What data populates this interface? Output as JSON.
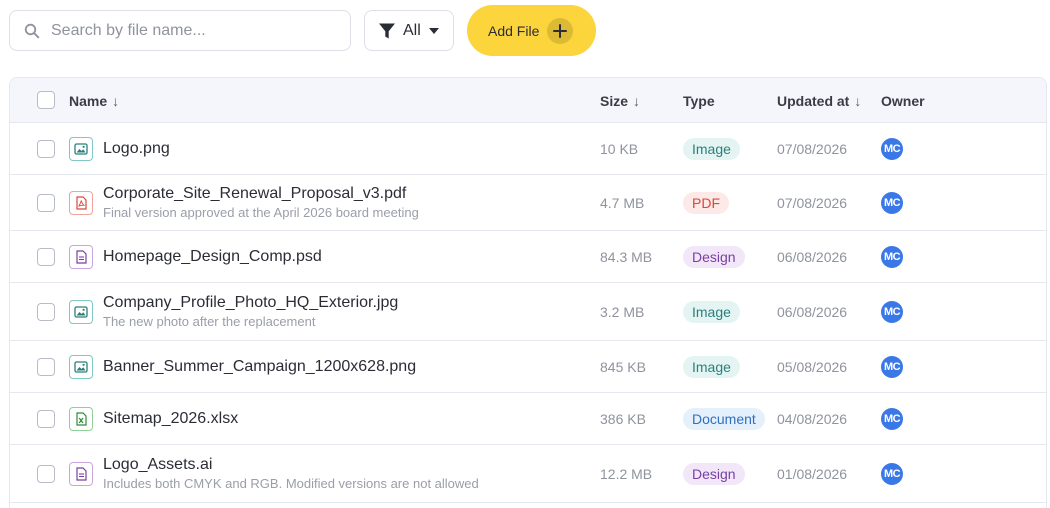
{
  "toolbar": {
    "search_placeholder": "Search by file name...",
    "search_value": "",
    "filter_label": "All",
    "add_label": "Add File"
  },
  "columns": {
    "name": "Name",
    "size": "Size",
    "type": "Type",
    "updated": "Updated at",
    "owner": "Owner",
    "sort_arrow": "↓"
  },
  "colors": {
    "accent_button": "#fcd43c",
    "avatar": "#3b78e7"
  },
  "files": [
    {
      "name": "Logo.png",
      "desc": "",
      "size": "10 KB",
      "type": "Image",
      "type_key": "image",
      "icon": "image-icon",
      "updated": "07/08/2026",
      "owner": "MC"
    },
    {
      "name": "Corporate_Site_Renewal_Proposal_v3.pdf",
      "desc": "Final version approved at the April 2026 board meeting",
      "size": "4.7 MB",
      "type": "PDF",
      "type_key": "pdf",
      "icon": "pdf-icon",
      "updated": "07/08/2026",
      "owner": "MC"
    },
    {
      "name": "Homepage_Design_Comp.psd",
      "desc": "",
      "size": "84.3 MB",
      "type": "Design",
      "type_key": "design",
      "icon": "document-icon",
      "updated": "06/08/2026",
      "owner": "MC"
    },
    {
      "name": "Company_Profile_Photo_HQ_Exterior.jpg",
      "desc": "The new photo after the replacement",
      "size": "3.2 MB",
      "type": "Image",
      "type_key": "image",
      "icon": "image-icon",
      "updated": "06/08/2026",
      "owner": "MC"
    },
    {
      "name": "Banner_Summer_Campaign_1200x628.png",
      "desc": "",
      "size": "845 KB",
      "type": "Image",
      "type_key": "image",
      "icon": "image-icon",
      "updated": "05/08/2026",
      "owner": "MC"
    },
    {
      "name": "Sitemap_2026.xlsx",
      "desc": "",
      "size": "386 KB",
      "type": "Document",
      "type_key": "document",
      "icon": "spreadsheet-icon",
      "updated": "04/08/2026",
      "owner": "MC"
    },
    {
      "name": "Logo_Assets.ai",
      "desc": "Includes both CMYK and RGB. Modified versions are not allowed",
      "size": "12.2 MB",
      "type": "Design",
      "type_key": "design",
      "icon": "document-icon",
      "updated": "01/08/2026",
      "owner": "MC"
    }
  ]
}
